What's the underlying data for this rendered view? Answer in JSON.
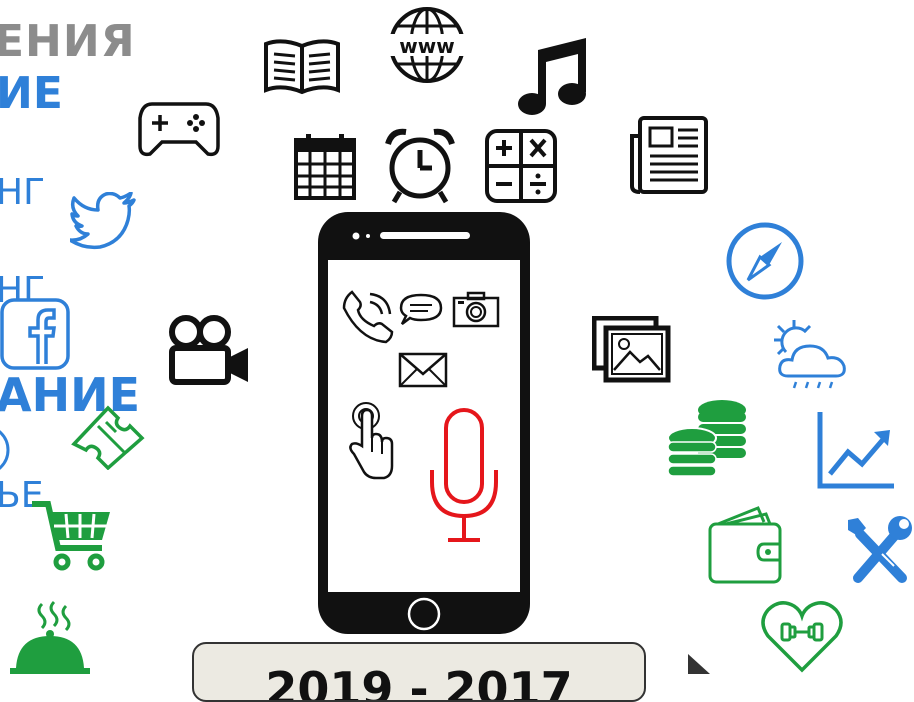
{
  "left_text": {
    "line1": "ЕНИЯ",
    "line2": "ИЕ",
    "line3": "НГ",
    "line4": "НГ",
    "line5": "АНИЕ",
    "line6": "ЬЕ"
  },
  "caption": {
    "text": "2019 - 2017"
  },
  "icons": [
    "book-icon",
    "globe-www-icon",
    "music-note-icon",
    "gamepad-icon",
    "calendar-icon",
    "alarm-clock-icon",
    "calculator-icon",
    "newspaper-icon",
    "twitter-bird-icon",
    "facebook-icon",
    "video-camera-icon",
    "gallery-icon",
    "compass-icon",
    "weather-icon",
    "coins-icon",
    "chart-up-icon",
    "ticket-icon",
    "shopping-cart-icon",
    "wallet-icon",
    "tools-icon",
    "food-cloche-icon",
    "heart-dumbbell-icon",
    "smartphone-icon",
    "phone-call-icon",
    "chat-bubble-icon",
    "camera-icon",
    "envelope-icon",
    "touch-hand-icon",
    "microphone-icon",
    "play-arrow-icon"
  ],
  "colors": {
    "gray_text": "#8c8c8c",
    "blue_accent": "#2f80d8",
    "green_accent": "#1f9e3f",
    "red_mic": "#e5161b",
    "black": "#111111"
  }
}
